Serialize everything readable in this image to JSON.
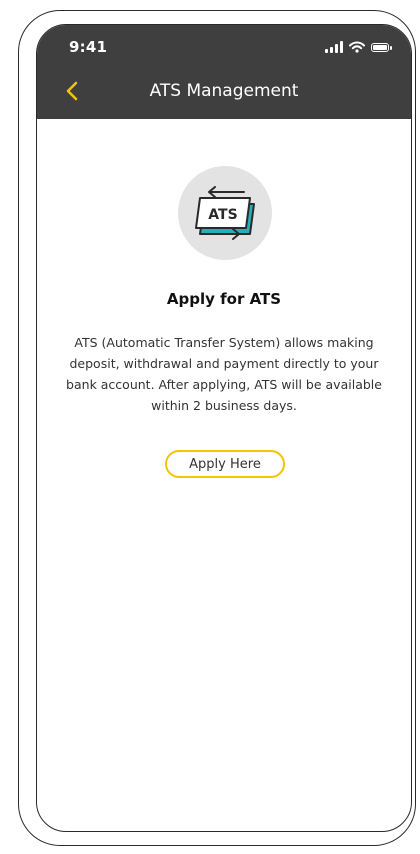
{
  "status_bar": {
    "time": "9:41",
    "icons": [
      "signal-icon",
      "wifi-icon",
      "battery-icon"
    ]
  },
  "header": {
    "back_icon": "chevron-left-icon",
    "title": "ATS Management"
  },
  "main": {
    "illustration_icon": "ats-icon",
    "illustration_text": "ATS",
    "heading": "Apply for ATS",
    "description": "ATS (Automatic Transfer System) allows making deposit, withdrawal and payment directly to your bank account. After applying, ATS will be available within 2 business days.",
    "apply_button_label": "Apply Here"
  },
  "colors": {
    "header_bg": "#3f3f3f",
    "accent_yellow": "#f2c500",
    "illustration_teal": "#23b1b6",
    "illustration_circle": "#e3e3e3"
  }
}
